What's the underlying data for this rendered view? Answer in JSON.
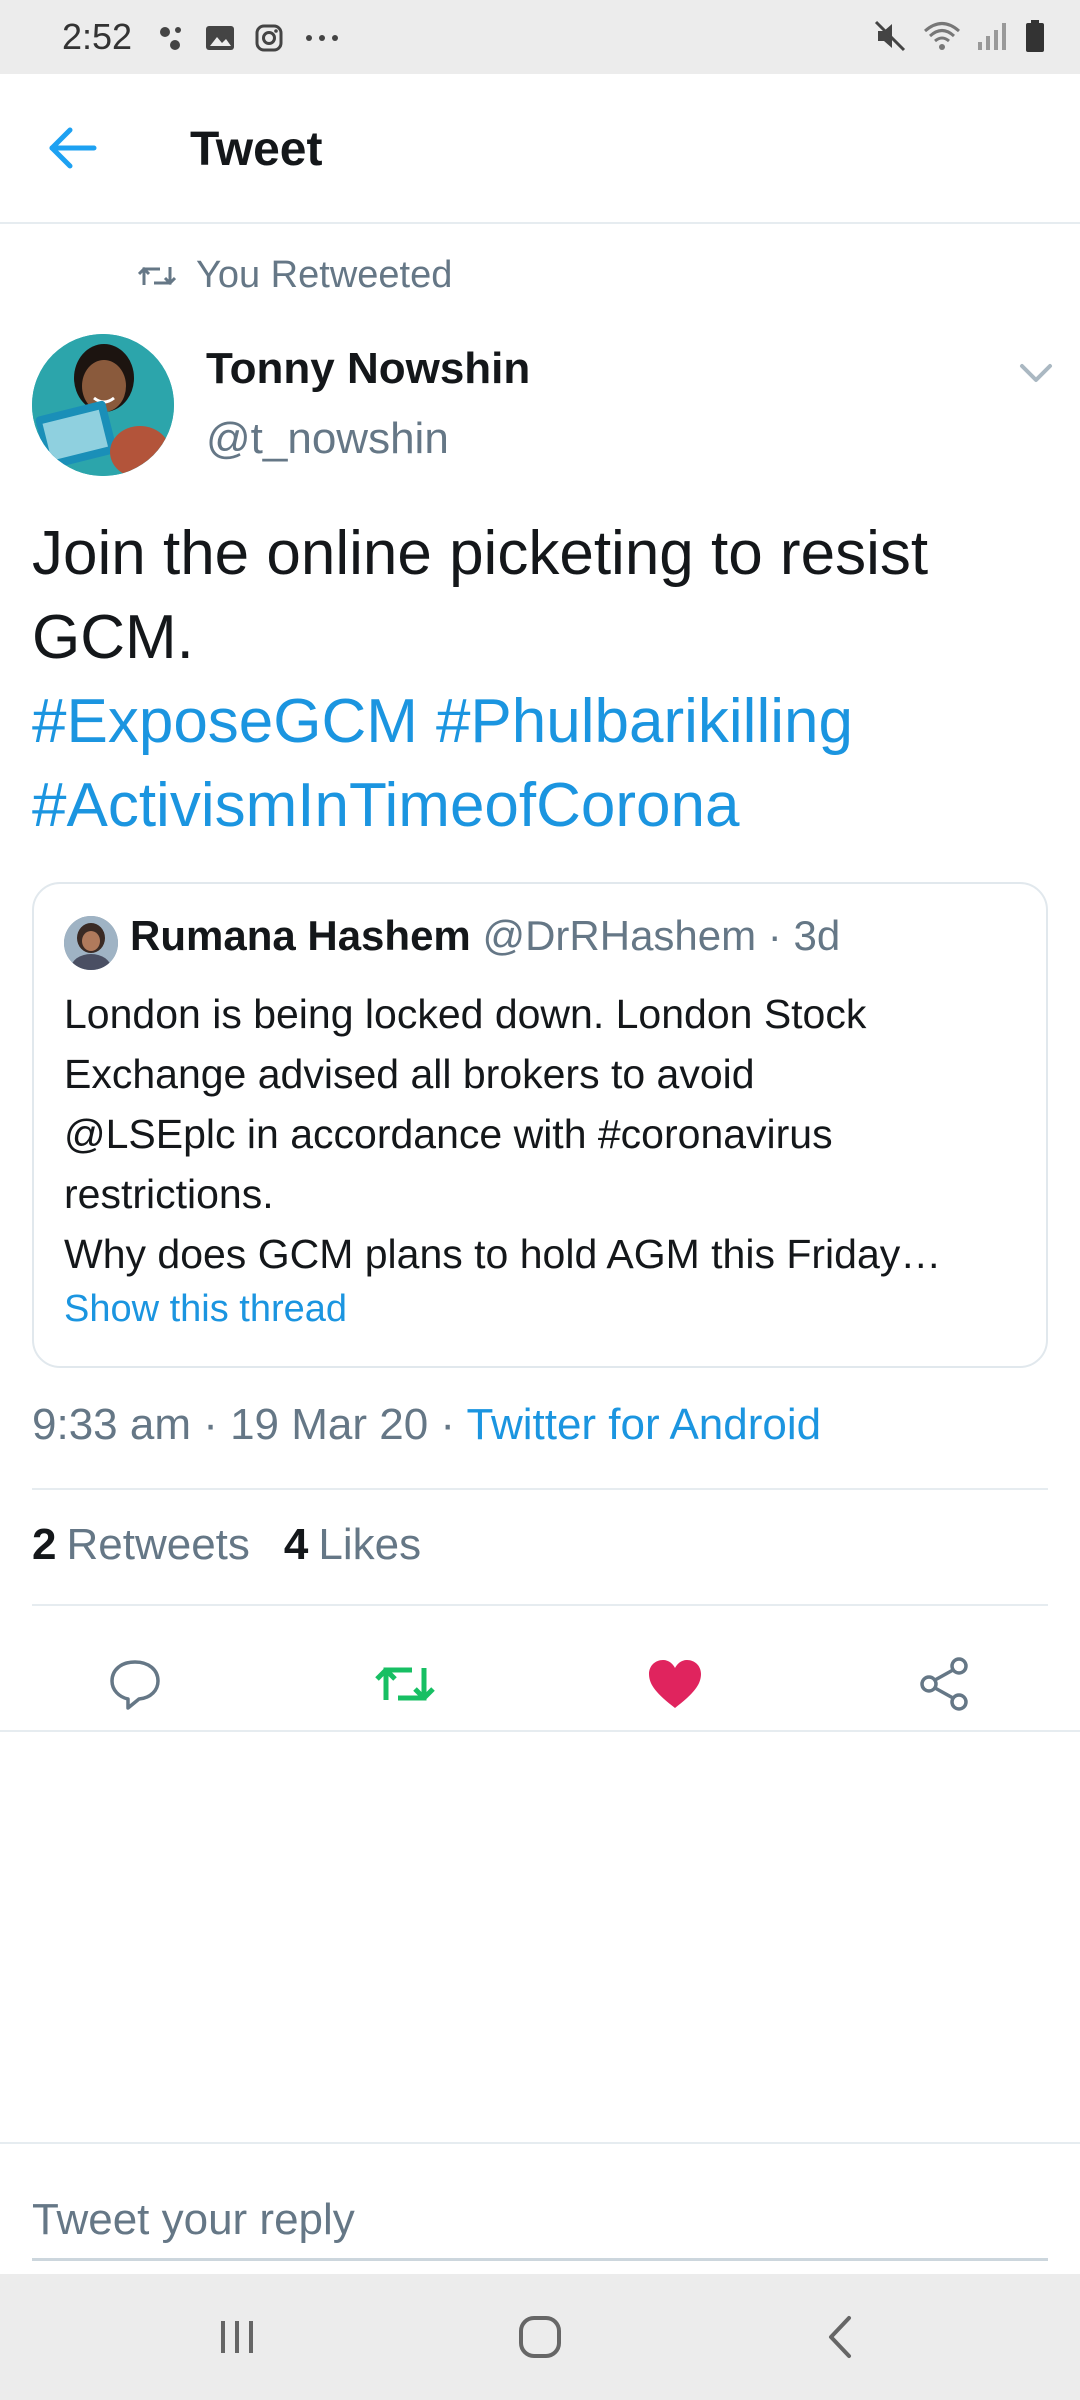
{
  "status_bar": {
    "time": "2:52",
    "left_icons": [
      "assistant-dots-icon",
      "gallery-icon",
      "instagram-icon",
      "more-dots-icon"
    ],
    "right_icons": [
      "mute-icon",
      "wifi-icon",
      "signal-icon",
      "battery-icon"
    ]
  },
  "header": {
    "title": "Tweet",
    "back_icon": "arrow-left-icon"
  },
  "retweet_note": "You Retweeted",
  "author": {
    "name": "Tonny Nowshin",
    "handle": "@t_nowshin"
  },
  "tweet": {
    "text": "Join the online picketing to resist GCM.",
    "hashtags": [
      "#ExposeGCM",
      "#Phulbarikilling",
      "#ActivismInTimeofCorona"
    ]
  },
  "quote": {
    "name": "Rumana Hashem",
    "handle_time": "@DrRHashem · 3d",
    "lines": [
      "London is being locked down. London Stock",
      "Exchange advised all brokers to avoid",
      "@LSEplc in accordance with #coronavirus",
      "restrictions.",
      "Why does GCM plans to hold AGM this Friday…"
    ],
    "show_thread": "Show this thread"
  },
  "meta": {
    "time_date": "9:33 am · 19 Mar 20 · ",
    "source": "Twitter for Android"
  },
  "stats": {
    "retweets_count": "2",
    "retweets_label": "Retweets",
    "likes_count": "4",
    "likes_label": "Likes"
  },
  "actions": {
    "reply_icon": "reply-icon",
    "retweet_icon": "retweet-icon",
    "like_icon": "heart-icon",
    "share_icon": "share-icon",
    "retweet_color": "#17bf63",
    "like_color": "#e0245e"
  },
  "reply": {
    "placeholder": "Tweet your reply"
  },
  "colors": {
    "accent": "#1b95e0",
    "secondary_text": "#657786",
    "primary_text": "#14171a"
  }
}
